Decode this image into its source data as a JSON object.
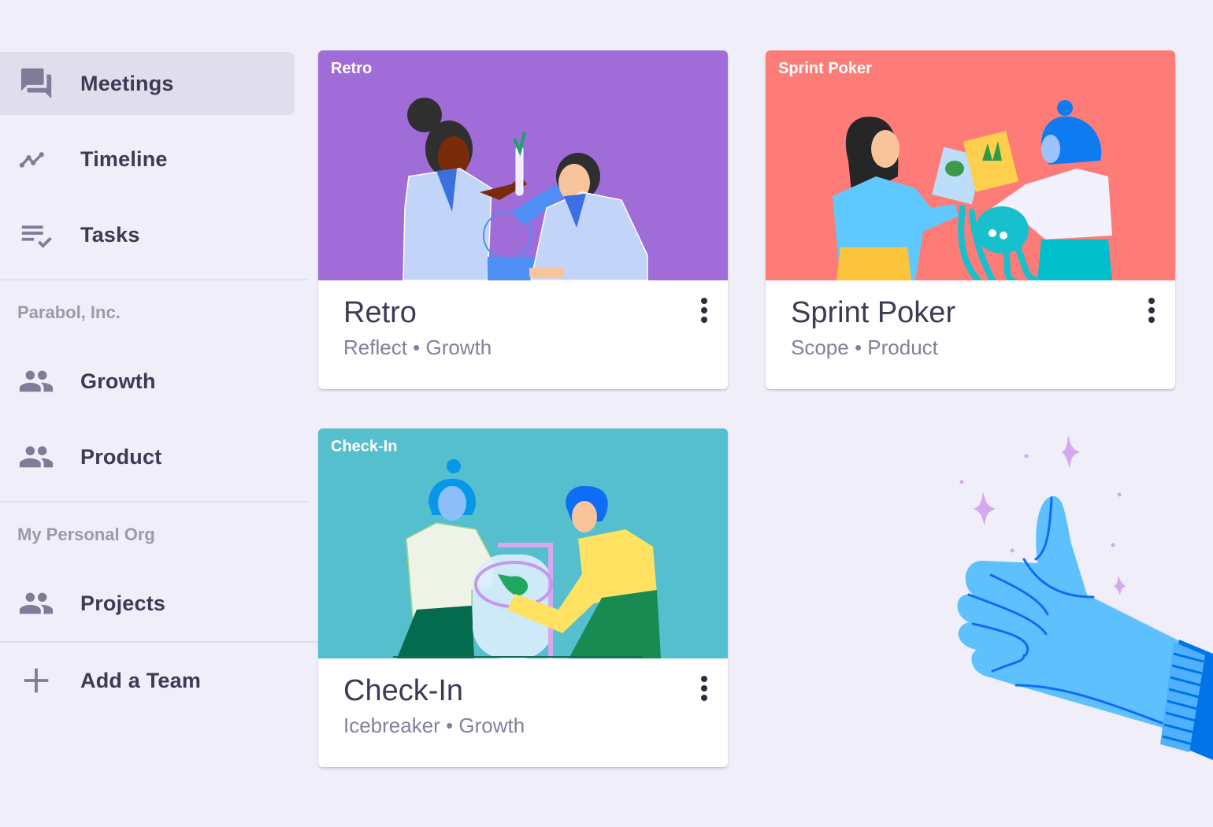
{
  "sidebar": {
    "nav": [
      {
        "label": "Meetings",
        "icon": "forum-icon",
        "active": true
      },
      {
        "label": "Timeline",
        "icon": "timeline-icon",
        "active": false
      },
      {
        "label": "Tasks",
        "icon": "playlist-check-icon",
        "active": false
      }
    ],
    "orgs": [
      {
        "name": "Parabol, Inc.",
        "teams": [
          {
            "label": "Growth",
            "icon": "group-icon"
          },
          {
            "label": "Product",
            "icon": "group-icon"
          }
        ]
      },
      {
        "name": "My Personal Org",
        "teams": [
          {
            "label": "Projects",
            "icon": "group-icon"
          }
        ]
      }
    ],
    "add_team": {
      "label": "Add a Team",
      "icon": "plus-icon"
    }
  },
  "meetings": [
    {
      "banner_label": "Retro",
      "title": "Retro",
      "subtitle": "Reflect • Growth",
      "color": "#9F6CD8",
      "illustration": "two-scientists-microscope"
    },
    {
      "banner_label": "Sprint Poker",
      "title": "Sprint Poker",
      "subtitle": "Scope • Product",
      "color": "#FD7C78",
      "illustration": "two-people-cards-octopus"
    },
    {
      "banner_label": "Check-In",
      "title": "Check-In",
      "subtitle": "Icebreaker • Growth",
      "color": "#55BFCE",
      "illustration": "two-people-plant-jar"
    }
  ],
  "decoration": {
    "illustration": "thumbs-up-glove"
  },
  "colors": {
    "background": "#F0EEF9",
    "active_nav": "#E0DEEC",
    "text_primary": "#3D3B54",
    "text_secondary": "#82809A",
    "icon": "#7F7C99",
    "org_label": "#9C99AC"
  }
}
